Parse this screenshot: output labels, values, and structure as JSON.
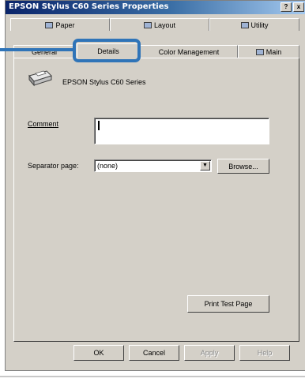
{
  "window": {
    "title": "EPSON Stylus C60 Series Properties",
    "help_button": "?",
    "close_button": "x"
  },
  "tabs": {
    "row_back": [
      {
        "label": "Paper",
        "icon": "paper-icon"
      },
      {
        "label": "Layout",
        "icon": "layout-icon"
      },
      {
        "label": "Utility",
        "icon": "utility-icon"
      }
    ],
    "row_front": [
      {
        "label": "General"
      },
      {
        "label": "Details",
        "active": true
      },
      {
        "label": "Color Management"
      },
      {
        "label": "Main",
        "icon": "main-icon"
      }
    ]
  },
  "printer": {
    "name": "EPSON Stylus C60 Series",
    "icon": "printer-icon"
  },
  "form": {
    "comment_label": "Comment",
    "comment_value": "",
    "separator_label": "Separator page:",
    "separator_value": "(none)",
    "browse_label": "Browse..."
  },
  "actions": {
    "print_test_page": "Print Test Page"
  },
  "footer": {
    "ok": "OK",
    "cancel": "Cancel",
    "apply": "Apply",
    "help": "Help"
  },
  "colors": {
    "highlight": "#2f74b8",
    "title_bar": "#0a246a",
    "dialog_bg": "#d4d0c8"
  }
}
